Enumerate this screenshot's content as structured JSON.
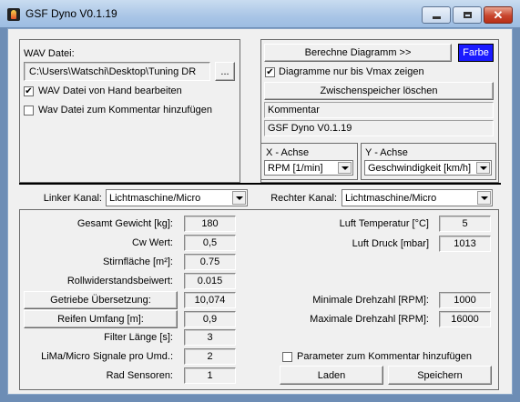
{
  "window": {
    "title": "GSF Dyno V0.1.19"
  },
  "wav": {
    "label": "WAV Datei:",
    "path": "C:\\Users\\Watschi\\Desktop\\Tuning DR",
    "browse": "...",
    "manual_edit": {
      "label": "WAV Datei von Hand bearbeiten",
      "checked": true,
      "mark": "✔"
    },
    "add_comment": {
      "label": "Wav Datei zum Kommentar hinzufügen",
      "checked": false
    }
  },
  "diagram": {
    "compute_button": "Berechne Diagramm >>",
    "color_button": "Farbe",
    "color": "#1a1aff",
    "vmax_only": {
      "label": "Diagramme nur bis Vmax zeigen",
      "checked": true,
      "mark": "✔"
    },
    "clear_cache_button": "Zwischenspeicher löschen",
    "comment_label": "Kommentar",
    "comment_value": "GSF Dyno V0.1.19",
    "x_axis": {
      "title": "X - Achse",
      "value": "RPM [1/min]"
    },
    "y_axis": {
      "title": "Y - Achse",
      "value": "Geschwindigkeit [km/h]"
    }
  },
  "channels": {
    "left_label": "Linker Kanal:",
    "left_value": "Lichtmaschine/Micro",
    "right_label": "Rechter Kanal:",
    "right_value": "Lichtmaschine/Micro"
  },
  "params": {
    "gewicht": {
      "label": "Gesamt Gewicht [kg]:",
      "value": "180"
    },
    "cw": {
      "label": "Cw Wert:",
      "value": "0,5"
    },
    "stirnflaeche": {
      "label": "Stirnfläche [m²]:",
      "value": "0.75"
    },
    "rollwiderstand": {
      "label": "Rollwiderstandsbeiwert:",
      "value": "0.015"
    },
    "getriebe": {
      "label": "Getriebe Übersetzung:",
      "value": "10,074"
    },
    "reifen": {
      "label": "Reifen Umfang [m]:",
      "value": "0,9"
    },
    "filter": {
      "label": "Filter Länge [s]:",
      "value": "3"
    },
    "lima": {
      "label": "LiMa/Micro Signale pro Umd.:",
      "value": "2"
    },
    "rad": {
      "label": "Rad Sensoren:",
      "value": "1"
    },
    "luft_temp": {
      "label": "Luft Temperatur [°C]",
      "value": "5"
    },
    "luft_druck": {
      "label": "Luft Druck [mbar]",
      "value": "1013"
    },
    "min_rpm": {
      "label": "Minimale Drehzahl [RPM]:",
      "value": "1000"
    },
    "max_rpm": {
      "label": "Maximale Drehzahl [RPM]:",
      "value": "16000"
    },
    "param_comment": {
      "label": "Parameter zum Kommentar hinzufügen",
      "checked": false
    },
    "load_button": "Laden",
    "save_button": "Speichern"
  }
}
